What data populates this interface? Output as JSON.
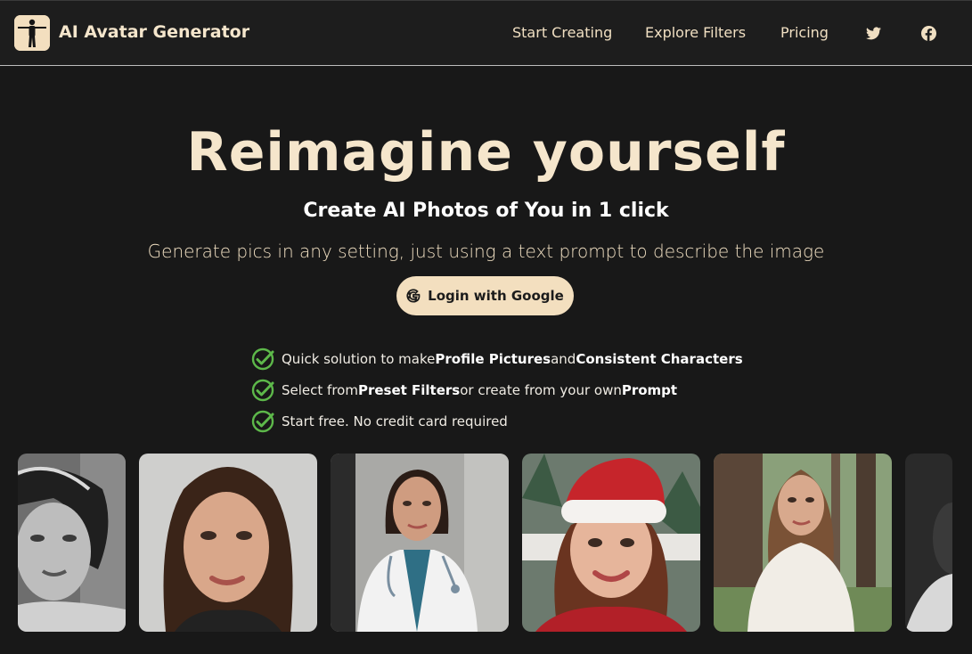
{
  "header": {
    "brand": "AI Avatar Generator",
    "nav": [
      "Start Creating",
      "Explore Filters",
      "Pricing"
    ],
    "social": [
      "twitter-icon",
      "facebook-icon"
    ]
  },
  "hero": {
    "title": "Reimagine yourself",
    "subtitle": "Create AI Photos of You in 1 click",
    "description": "Generate pics in any setting, just using a text prompt to describe the image",
    "cta": "Login with Google"
  },
  "features": [
    {
      "a": "Quick solution to make ",
      "b": "Profile Pictures",
      "c": " and ",
      "d": "Consistent Characters"
    },
    {
      "a": "Select from ",
      "b": "Preset Filters",
      "c": " or create from your own ",
      "d": "Prompt"
    },
    {
      "a": "Start free. No credit card required",
      "b": "",
      "c": "",
      "d": ""
    }
  ],
  "colors": {
    "background": "#181818",
    "accent": "#f3dfbf",
    "check": "#5db84a"
  }
}
